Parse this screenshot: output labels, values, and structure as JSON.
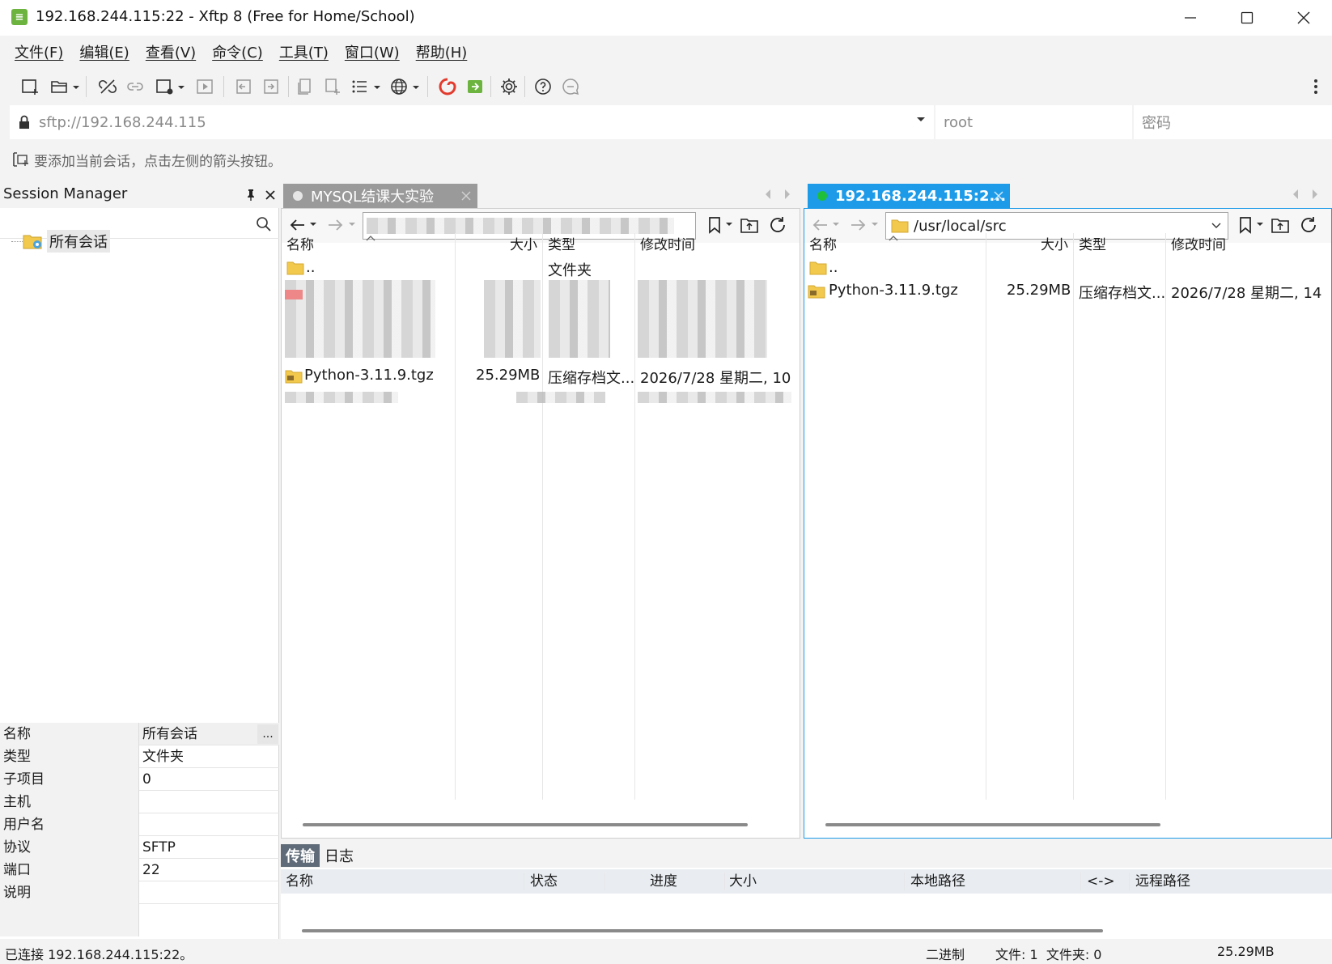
{
  "window": {
    "title": "192.168.244.115:22 - Xftp 8 (Free for Home/School)",
    "app_icon": "xftp-icon"
  },
  "menu": [
    "文件(F)",
    "编辑(E)",
    "查看(V)",
    "命令(C)",
    "工具(T)",
    "窗口(W)",
    "帮助(H)"
  ],
  "address": {
    "url_placeholder": "sftp://192.168.244.115",
    "user_placeholder": "root",
    "password_placeholder": "密码"
  },
  "hint": "要添加当前会话，点击左侧的箭头按钮。",
  "session_manager": {
    "title": "Session Manager",
    "tree_root": "所有会话",
    "properties": [
      {
        "key": "名称",
        "value": "所有会话"
      },
      {
        "key": "类型",
        "value": "文件夹"
      },
      {
        "key": "子项目",
        "value": "0"
      },
      {
        "key": "主机",
        "value": ""
      },
      {
        "key": "用户名",
        "value": ""
      },
      {
        "key": "协议",
        "value": "SFTP"
      },
      {
        "key": "端口",
        "value": "22"
      },
      {
        "key": "说明",
        "value": ""
      }
    ],
    "more_button": "..."
  },
  "local_pane": {
    "tab_label": "MYSQL结课大实验",
    "columns": {
      "name": "名称",
      "size": "大小",
      "type": "类型",
      "modified": "修改时间"
    },
    "parent_row": {
      "name": "..",
      "type": "文件夹"
    },
    "file": {
      "name": "Python-3.11.9.tgz",
      "size": "25.29MB",
      "type": "压缩存档文...",
      "modified": "2026/7/28 星期二, 10"
    }
  },
  "remote_pane": {
    "tab_label": "192.168.244.115:2...",
    "path": "/usr/local/src",
    "columns": {
      "name": "名称",
      "size": "大小",
      "type": "类型",
      "modified": "修改时间"
    },
    "parent_row": {
      "name": ".."
    },
    "file": {
      "name": "Python-3.11.9.tgz",
      "size": "25.29MB",
      "type": "压缩存档文...",
      "modified": "2026/7/28 星期二, 14"
    }
  },
  "transfer": {
    "tabs": [
      "传输",
      "日志"
    ],
    "columns": [
      "名称",
      "状态",
      "进度",
      "大小",
      "本地路径",
      "<->",
      "远程路径"
    ]
  },
  "status": {
    "connection": "已连接 192.168.244.115:22。",
    "mode": "二进制",
    "counts": "文件: 1  文件夹: 0",
    "size": "25.29MB"
  },
  "colors": {
    "accent": "#1e9be8",
    "connected": "#1fbf3a",
    "folder": "#f2c94c"
  }
}
